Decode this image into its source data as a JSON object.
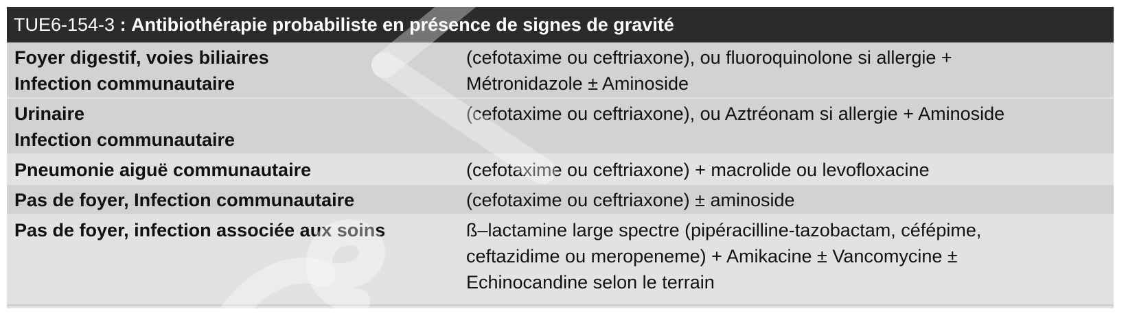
{
  "title": {
    "code": "TUE6-154-3",
    "separator": ":",
    "text": "Antibiothérapie probabiliste en présence de signes de gravité"
  },
  "rows": [
    {
      "site": [
        "Foyer digestif, voies biliaires",
        "Infection communautaire"
      ],
      "treatment": [
        "(cefotaxime ou ceftriaxone), ou fluoroquinolone si allergie +",
        "Métronidazole ± Aminoside"
      ]
    },
    {
      "site": [
        "Urinaire",
        "Infection communautaire"
      ],
      "treatment": [
        "(cefotaxime ou ceftriaxone), ou Aztréonam si allergie + Aminoside"
      ]
    },
    {
      "site": [
        "Pneumonie aiguë communautaire"
      ],
      "treatment": [
        "(cefotaxime ou ceftriaxone) + macrolide ou levofloxacine"
      ]
    },
    {
      "site": [
        "Pas de foyer, Infection communautaire"
      ],
      "treatment": [
        "(cefotaxime ou ceftriaxone) ± aminoside"
      ]
    },
    {
      "site": [
        "Pas de foyer, infection associée aux soins"
      ],
      "treatment": [
        "ß–lactamine large spectre (pipéracilline-tazobactam, céfépime,",
        "ceftazidime ou meropeneme) + Amikacine ± Vancomycine ±",
        "Echinocandine selon le terrain"
      ]
    }
  ],
  "colors": {
    "title_bar": "#2b2b2b",
    "row_dark": "#d2d2d2",
    "row_light": "#e2e2e2"
  }
}
